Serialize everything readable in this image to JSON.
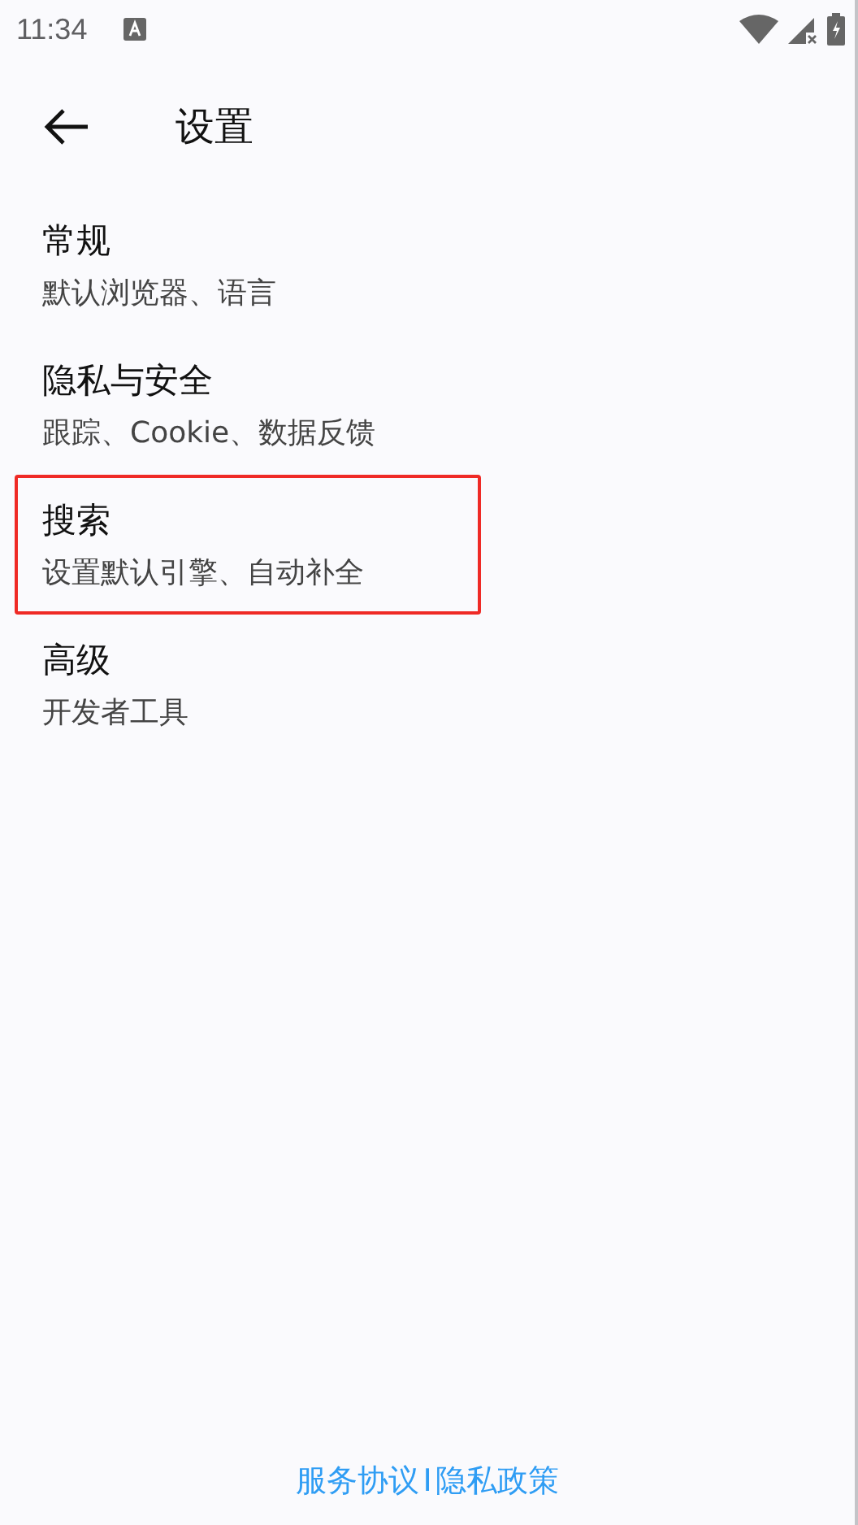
{
  "status_bar": {
    "time": "11:34"
  },
  "app_bar": {
    "title": "设置"
  },
  "items": [
    {
      "title": "常规",
      "subtitle": "默认浏览器、语言",
      "highlighted": false
    },
    {
      "title": "隐私与安全",
      "subtitle": "跟踪、Cookie、数据反馈",
      "highlighted": false
    },
    {
      "title": "搜索",
      "subtitle": "设置默认引擎、自动补全",
      "highlighted": true
    },
    {
      "title": "高级",
      "subtitle": "开发者工具",
      "highlighted": false
    }
  ],
  "footer": {
    "links": [
      "服务协议",
      "隐私政策"
    ],
    "separator": "I"
  }
}
